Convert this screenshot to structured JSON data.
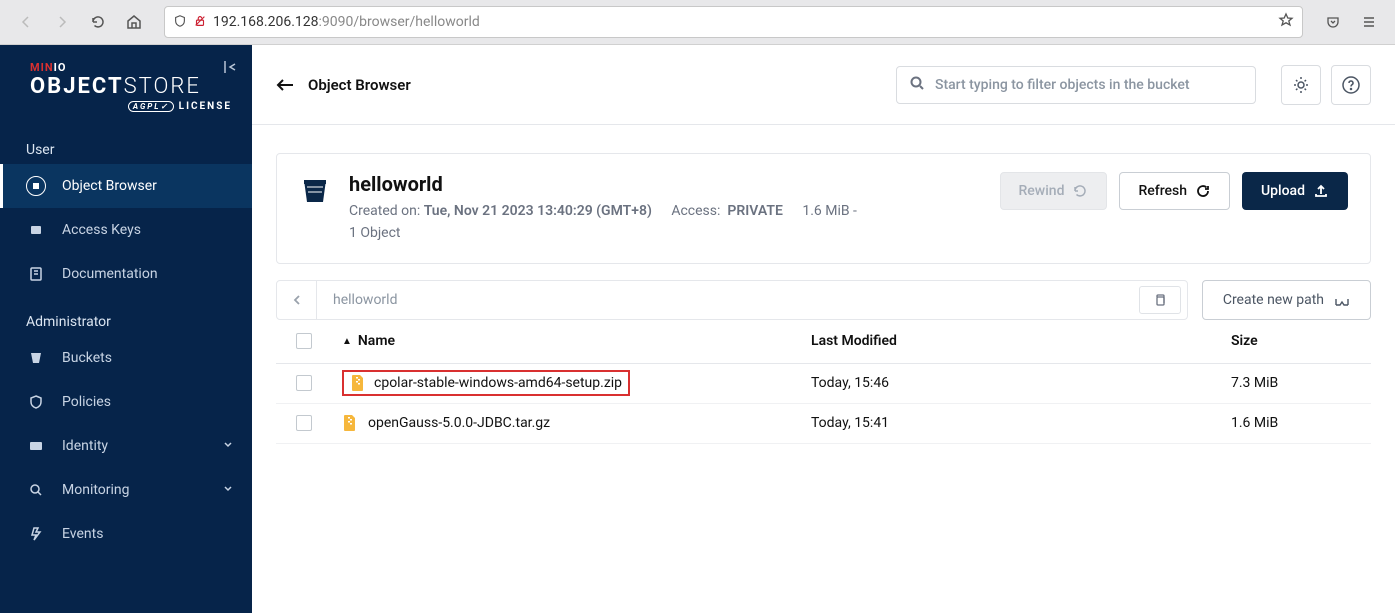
{
  "browser": {
    "url_prefix": "192.168.206.128",
    "url_port": ":9090",
    "url_path": "/browser/helloworld"
  },
  "sidebar": {
    "sections": {
      "user": "User",
      "admin": "Administrator"
    },
    "items": {
      "object_browser": "Object Browser",
      "access_keys": "Access Keys",
      "documentation": "Documentation",
      "buckets": "Buckets",
      "policies": "Policies",
      "identity": "Identity",
      "monitoring": "Monitoring",
      "events": "Events"
    }
  },
  "topbar": {
    "title": "Object Browser",
    "search_placeholder": "Start typing to filter objects in the bucket"
  },
  "bucket": {
    "name": "helloworld",
    "created_label": "Created on:",
    "created_value": "Tue, Nov 21 2023 13:40:29 (GMT+8)",
    "access_label": "Access:",
    "access_value": "PRIVATE",
    "size": "1.6 MiB",
    "objects": "1 Object",
    "btn_rewind": "Rewind",
    "btn_refresh": "Refresh",
    "btn_upload": "Upload"
  },
  "breadcrumb": {
    "path": "helloworld",
    "btn_newpath": "Create new path"
  },
  "table": {
    "headers": {
      "name": "Name",
      "modified": "Last Modified",
      "size": "Size"
    },
    "rows": [
      {
        "name": "cpolar-stable-windows-amd64-setup.zip",
        "modified": "Today, 15:46",
        "size": "7.3 MiB",
        "highlighted": true
      },
      {
        "name": "openGauss-5.0.0-JDBC.tar.gz",
        "modified": "Today, 15:41",
        "size": "1.6 MiB",
        "highlighted": false
      }
    ]
  }
}
